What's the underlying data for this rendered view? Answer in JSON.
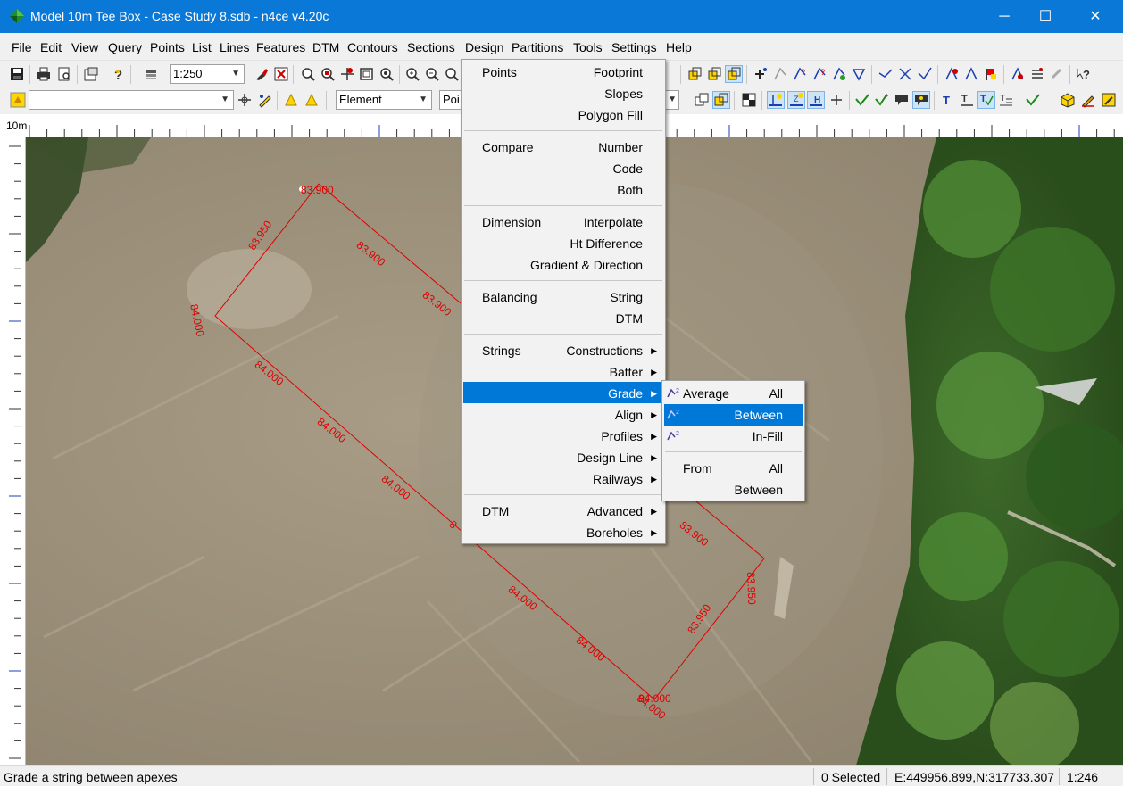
{
  "window": {
    "title": "Model 10m Tee Box - Case Study 8.sdb - n4ce v4.20c",
    "minimize": "─",
    "maximize": "☐",
    "close": "✕"
  },
  "menubar": [
    "File",
    "Edit",
    "View",
    "Query",
    "Points",
    "List",
    "Lines",
    "Features",
    "DTM",
    "Contours",
    "Sections",
    "Design",
    "Partitions",
    "Tools",
    "Settings",
    "Help"
  ],
  "toolbar": {
    "scale_value": "1:250",
    "layer_value": "",
    "element_value": "Element",
    "point_value": "Poi"
  },
  "ruler": {
    "scale_label": "10m"
  },
  "design_menu": {
    "points": {
      "label": "Points",
      "opts": [
        "Footprint",
        "Slopes",
        "Polygon Fill"
      ]
    },
    "compare": {
      "label": "Compare",
      "opts": [
        "Number",
        "Code",
        "Both"
      ]
    },
    "dimension": {
      "label": "Dimension",
      "opts": [
        "Interpolate",
        "Ht Difference",
        "Gradient & Direction"
      ]
    },
    "balancing": {
      "label": "Balancing",
      "opts": [
        "String",
        "DTM"
      ]
    },
    "strings": {
      "label": "Strings",
      "opts": [
        "Constructions",
        "Batter",
        "Grade",
        "Align",
        "Profiles",
        "Design Line",
        "Railways"
      ]
    },
    "dtm": {
      "label": "DTM",
      "opts": [
        "Advanced",
        "Boreholes"
      ]
    }
  },
  "grade_submenu": {
    "average": "Average",
    "average_all": "All",
    "between": "Between",
    "infill": "In-Fill",
    "from": "From",
    "from_all": "All",
    "from_between": "Between"
  },
  "map_labels": [
    "83.900",
    "83.900",
    "83.900",
    "83.950",
    "84.000",
    "84.000",
    "84.000",
    "84.000",
    "84.000",
    "84.000",
    "84.000",
    "83.900",
    "83.950",
    "83.950",
    "84.000",
    "8"
  ],
  "status": {
    "message": "Grade a string between apexes",
    "selected": "0 Selected",
    "coords": "E:449956.899,N:317733.307",
    "scale": "1:246"
  },
  "colors": {
    "accent": "#0078d7",
    "titlebar": "#0a78d7",
    "string_line": "#e00000"
  }
}
